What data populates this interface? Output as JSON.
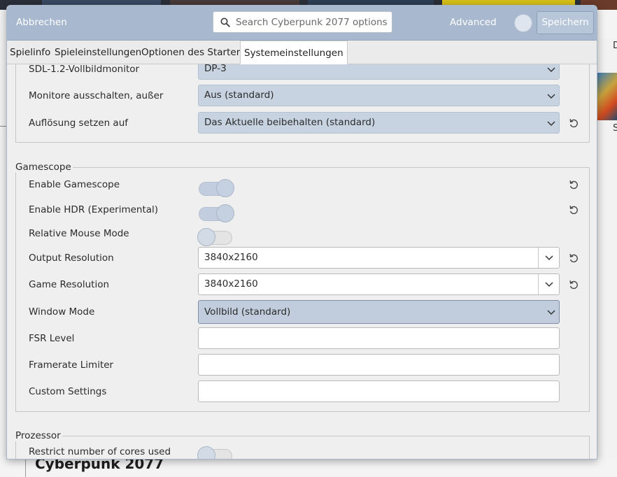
{
  "background": {
    "game_title": "Cyberpunk 2077",
    "side_letters": [
      "D",
      "S"
    ]
  },
  "header": {
    "cancel_label": "Abbrechen",
    "search_placeholder": "Search Cyberpunk 2077 options",
    "advanced_label": "Advanced",
    "save_label": "Speichern"
  },
  "tabs": [
    {
      "label": "Spielinfo",
      "active": false
    },
    {
      "label": "Spieleinstellungen",
      "active": false
    },
    {
      "label": "Optionen des Starters",
      "active": false
    },
    {
      "label": "Systemeinstellungen",
      "active": true
    }
  ],
  "display": {
    "rows": [
      {
        "label": "SDL-1.2-Vollbildmonitor",
        "value": "DP-3"
      },
      {
        "label": "Monitore ausschalten, außer",
        "value": "Aus (standard)"
      },
      {
        "label": "Auflösung setzen auf",
        "value": "Das Aktuelle beibehalten (standard)"
      }
    ]
  },
  "gamescope": {
    "title": "Gamescope",
    "enable_gamescope": {
      "label": "Enable Gamescope",
      "on": true
    },
    "enable_hdr": {
      "label": "Enable HDR (Experimental)",
      "on": true
    },
    "relative_mouse": {
      "label": "Relative Mouse Mode",
      "on": false
    },
    "output_resolution": {
      "label": "Output Resolution",
      "value": "3840x2160"
    },
    "game_resolution": {
      "label": "Game Resolution",
      "value": "3840x2160"
    },
    "window_mode": {
      "label": "Window Mode",
      "value": "Vollbild (standard)"
    },
    "fsr_level": {
      "label": "FSR Level",
      "value": ""
    },
    "framerate_limiter": {
      "label": "Framerate Limiter",
      "value": ""
    },
    "custom_settings": {
      "label": "Custom Settings",
      "value": ""
    }
  },
  "processor": {
    "title": "Prozessor",
    "restrict_cores": {
      "label": "Restrict number of cores used",
      "on": false
    }
  },
  "colors": {
    "headerbar": "#a7b8cf",
    "combo": "#c8d3e1"
  }
}
